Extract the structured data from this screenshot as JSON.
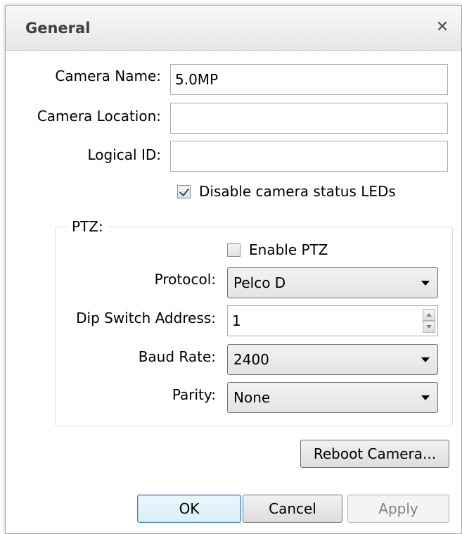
{
  "dialog": {
    "title": "General",
    "close_glyph": "✕"
  },
  "fields": {
    "camera_name": {
      "label": "Camera Name:",
      "value": "5.0MP"
    },
    "camera_location": {
      "label": "Camera Location:",
      "value": ""
    },
    "logical_id": {
      "label": "Logical ID:",
      "value": ""
    },
    "disable_leds": {
      "label": "Disable camera status LEDs",
      "checked": true
    }
  },
  "ptz": {
    "legend": "PTZ:",
    "enable": {
      "label": "Enable PTZ",
      "checked": false
    },
    "protocol": {
      "label": "Protocol:",
      "value": "Pelco D"
    },
    "dip_switch": {
      "label": "Dip Switch Address:",
      "value": "1"
    },
    "baud_rate": {
      "label": "Baud Rate:",
      "value": "2400"
    },
    "parity": {
      "label": "Parity:",
      "value": "None"
    }
  },
  "buttons": {
    "reboot": "Reboot Camera...",
    "ok": "OK",
    "cancel": "Cancel",
    "apply": "Apply"
  },
  "icons": {
    "close": "close-icon",
    "checkbox_checked": "checkmark-icon",
    "dropdown": "chevron-down-icon",
    "spin_up": "spin-up-icon",
    "spin_down": "spin-down-icon"
  },
  "colors": {
    "title_text": "#404040",
    "checkmark": "#1f4f8a",
    "default_button_border": "#3c7fb1",
    "disabled_text": "#838383"
  }
}
